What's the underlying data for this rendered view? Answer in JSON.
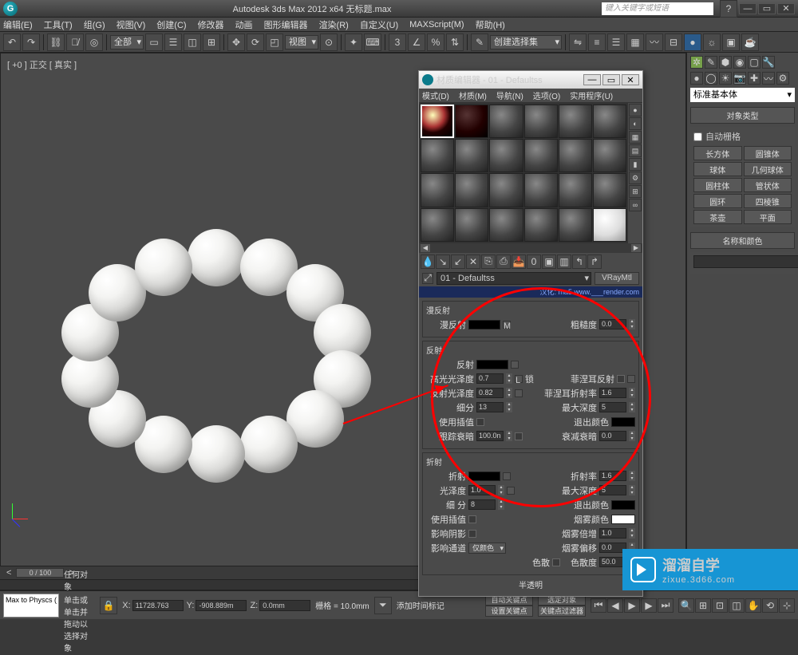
{
  "title": "Autodesk 3ds Max 2012 x64   无标题.max",
  "search_placeholder": "键入关键字或短语",
  "menu": [
    "编辑(E)",
    "工具(T)",
    "组(G)",
    "视图(V)",
    "创建(C)",
    "修改器",
    "动画",
    "图形编辑器",
    "渲染(R)",
    "自定义(U)",
    "MAXScript(M)",
    "帮助(H)"
  ],
  "toolbar_dd1": "全部",
  "toolbar_dd2": "视图",
  "toolbar_dd3": "创建选择集",
  "viewport_label": "[ +0 ] 正交 [ 真实 ]",
  "side": {
    "dd": "标准基本体",
    "rollout1": "对象类型",
    "autogrid": "自动栅格",
    "btns": [
      "长方体",
      "圆锥体",
      "球体",
      "几何球体",
      "圆柱体",
      "管状体",
      "圆环",
      "四棱锥",
      "茶壶",
      "平面"
    ],
    "rollout2": "名称和颜色"
  },
  "matedit": {
    "title": "材质编辑器 - 01 - Defaultss",
    "menu": [
      "模式(D)",
      "材质(M)",
      "导航(N)",
      "选项(O)",
      "实用程序(U)"
    ],
    "name": "01 - Defaultss",
    "type": "VRayMtl",
    "banner": "汉化: ma5 www.___render.com",
    "sec_diffuse": "漫反射",
    "lbl_diffuse": "漫反射",
    "lbl_rough": "粗糙度",
    "val_rough": "0.0",
    "sec_reflect": "反射",
    "lbl_reflect": "反射",
    "lbl_hilight": "高光光泽度",
    "val_hilight": "0.7",
    "lbl_lock": "锁",
    "lbl_fresnel": "菲涅耳反射",
    "lbl_rglossy": "反射光泽度",
    "val_rglossy": "0.82",
    "lbl_fresIOR": "菲涅耳折射率",
    "val_fresIOR": "1.6",
    "lbl_subdiv": "细分",
    "val_subdiv": "13",
    "lbl_maxdepth": "最大深度",
    "val_maxdepth": "5",
    "lbl_useinterp": "使用插值",
    "lbl_exitcolor": "退出颜色",
    "lbl_dimdist": "跟踪衰暗",
    "val_dimdist": "100.0n",
    "lbl_dimfall": "衰减衰暗",
    "val_dimfall": "0.0",
    "sec_refract": "折射",
    "lbl_refract": "折射",
    "lbl_ior": "折射率",
    "val_ior": "1.6",
    "lbl_glossy": "光泽度",
    "val_glossy": "1.0",
    "lbl_rmaxd": "最大深度",
    "val_rmaxd": "5",
    "lbl_rsub": "细 分",
    "val_rsub": "8",
    "lbl_rexit": "退出颜色",
    "lbl_ruseint": "使用插值",
    "lbl_fogcolor": "烟雾颜色",
    "lbl_shadows": "影响阴影",
    "lbl_fogmult": "烟雾倍增",
    "val_fogmult": "1.0",
    "lbl_affch": "影响通道",
    "val_affch": "仅颜色",
    "lbl_fogbias": "烟雾偏移",
    "val_fogbias": "0.0",
    "lbl_disp": "色散",
    "lbl_abbe": "色散度",
    "val_abbe": "50.0",
    "sec_translucent": "半透明"
  },
  "timeslider": "0 / 100",
  "status": {
    "script": "Max to Physcs (",
    "line1": "未选定任何对象",
    "line2": "单击或单击并拖动以选择对象",
    "x": "11728.763",
    "y": "-908.889m",
    "z": "0.0mm",
    "grid": "栅格 = 10.0mm",
    "addkey": "添加时间标记",
    "autokey": "自动关键点",
    "selset": "选定对象",
    "setkey": "设置关键点",
    "keyfilter": "关键点过滤器"
  },
  "watermark": {
    "big": "溜溜自学",
    "sm": "zixue.3d66.com"
  }
}
